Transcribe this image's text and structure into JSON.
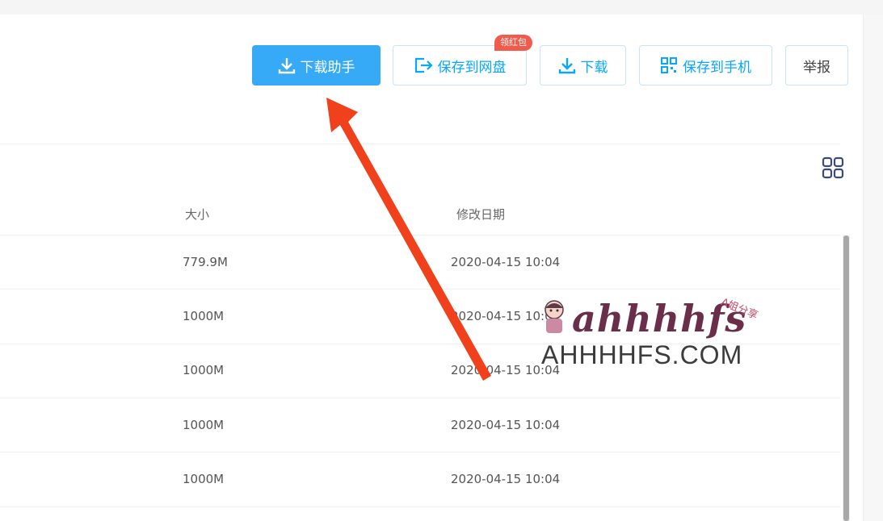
{
  "toolbar": {
    "download_assistant": "下载助手",
    "save_to_disk": "保存到网盘",
    "red_packet_badge": "领红包",
    "download": "下载",
    "save_to_phone": "保存到手机",
    "report": "举报"
  },
  "table": {
    "headers": {
      "size": "大小",
      "modified": "修改日期"
    },
    "rows": [
      {
        "size": "779.9M",
        "date": "2020-04-15 10:04"
      },
      {
        "size": "1000M",
        "date": "2020-04-15 10:04"
      },
      {
        "size": "1000M",
        "date": "2020-04-15 10:04"
      },
      {
        "size": "1000M",
        "date": "2020-04-15 10:04"
      },
      {
        "size": "1000M",
        "date": "2020-04-15 10:04"
      }
    ]
  },
  "watermark": {
    "logo": "ahhhhfs",
    "sub": "A姐分享",
    "url": "AHHHHFS.COM"
  },
  "colors": {
    "primary": "#37aaf7",
    "accent_text": "#06a7ff",
    "badge": "#f25b4b",
    "arrow": "#f0401c"
  },
  "icons": [
    "download-icon",
    "save-to-disk-icon",
    "qr-code-icon",
    "grid-view-icon"
  ]
}
